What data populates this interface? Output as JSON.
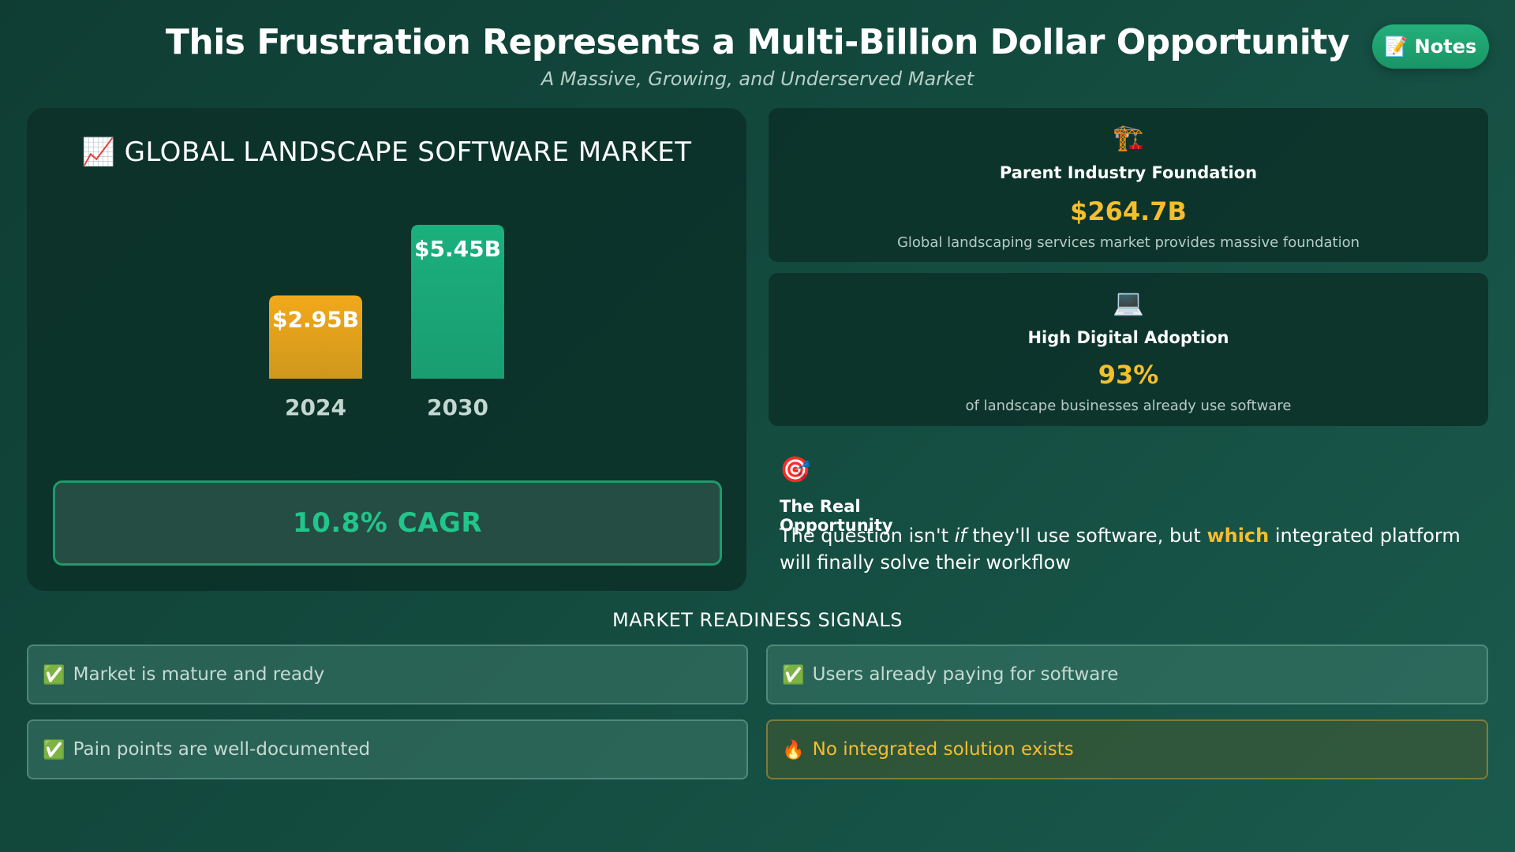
{
  "header": {
    "title": "This Frustration Represents a Multi-Billion Dollar Opportunity",
    "subtitle": "A Massive, Growing, and Underserved Market",
    "notes_label": "Notes",
    "notes_icon": "📝"
  },
  "chart_panel": {
    "icon": "📈",
    "title": "GLOBAL LANDSCAPE SOFTWARE MARKET",
    "cagr_label": "10.8% CAGR"
  },
  "chart_data": {
    "type": "bar",
    "title": "GLOBAL LANDSCAPE SOFTWARE MARKET",
    "categories": [
      "2024",
      "2030"
    ],
    "values": [
      2.95,
      5.45
    ],
    "data_labels": [
      "$2.95B",
      "$5.45B"
    ],
    "colors": [
      "#f2a91a",
      "#1bb07d"
    ],
    "xlabel": "",
    "ylabel": "",
    "grid": false
  },
  "cards": [
    {
      "icon": "🏗️",
      "heading": "Parent Industry Foundation",
      "value": "$264.7B",
      "description": "Global landscaping services market provides massive foundation"
    },
    {
      "icon": "💻",
      "heading": "High Digital Adoption",
      "value": "93%",
      "description": "of landscape businesses already use software"
    }
  ],
  "opportunity": {
    "icon": "🎯",
    "heading": "The Real Opportunity",
    "text_part1": "The question isn't ",
    "text_if": "if",
    "text_part2": " they'll use software, but ",
    "text_which": "which",
    "text_part3": " integrated platform will finally solve their workflow"
  },
  "signals": {
    "title": "MARKET READINESS SIGNALS",
    "items": [
      {
        "icon": "✅",
        "label": "Market is mature and ready"
      },
      {
        "icon": "✅",
        "label": "Users already paying for software"
      },
      {
        "icon": "✅",
        "label": "Pain points are well-documented"
      },
      {
        "icon": "🔥",
        "label": "No integrated solution exists"
      }
    ]
  },
  "colors": {
    "accent_green": "#1bb07d",
    "accent_yellow": "#f4be2e",
    "accent_orange": "#f2a91a"
  }
}
